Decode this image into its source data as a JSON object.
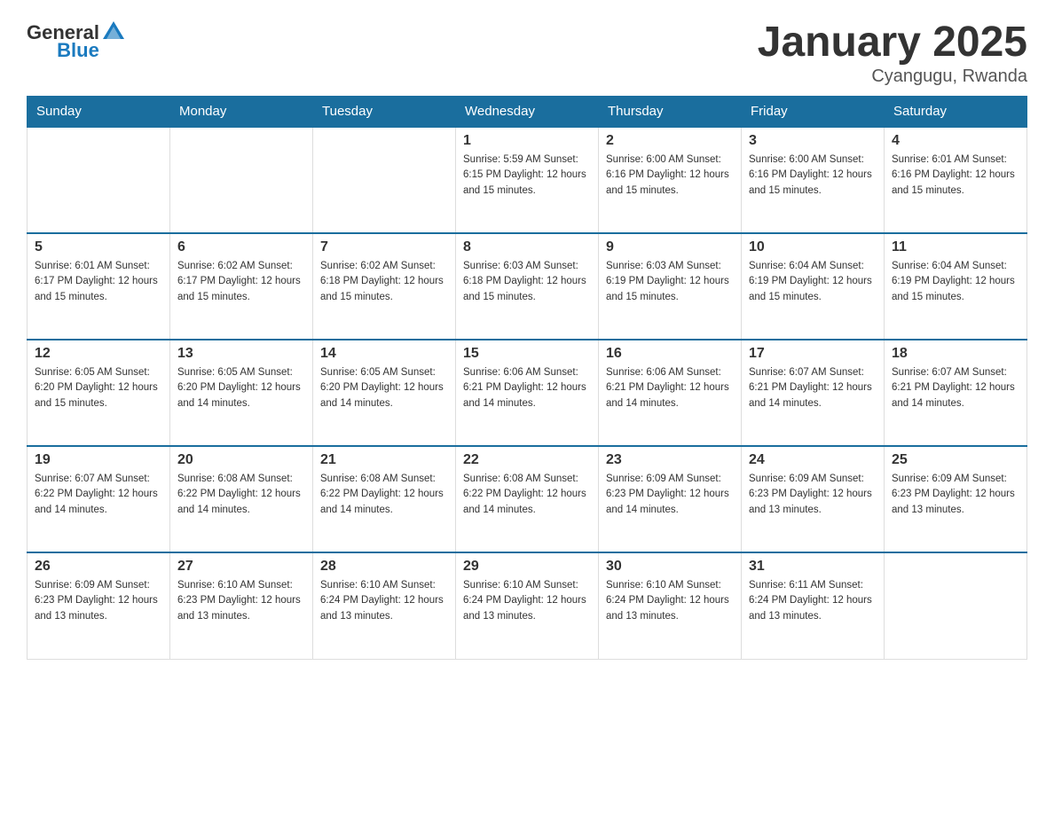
{
  "header": {
    "logo": {
      "general": "General",
      "blue": "Blue"
    },
    "title": "January 2025",
    "location": "Cyangugu, Rwanda"
  },
  "days_of_week": [
    "Sunday",
    "Monday",
    "Tuesday",
    "Wednesday",
    "Thursday",
    "Friday",
    "Saturday"
  ],
  "weeks": [
    {
      "days": [
        {
          "number": "",
          "info": ""
        },
        {
          "number": "",
          "info": ""
        },
        {
          "number": "",
          "info": ""
        },
        {
          "number": "1",
          "info": "Sunrise: 5:59 AM\nSunset: 6:15 PM\nDaylight: 12 hours\nand 15 minutes."
        },
        {
          "number": "2",
          "info": "Sunrise: 6:00 AM\nSunset: 6:16 PM\nDaylight: 12 hours\nand 15 minutes."
        },
        {
          "number": "3",
          "info": "Sunrise: 6:00 AM\nSunset: 6:16 PM\nDaylight: 12 hours\nand 15 minutes."
        },
        {
          "number": "4",
          "info": "Sunrise: 6:01 AM\nSunset: 6:16 PM\nDaylight: 12 hours\nand 15 minutes."
        }
      ]
    },
    {
      "days": [
        {
          "number": "5",
          "info": "Sunrise: 6:01 AM\nSunset: 6:17 PM\nDaylight: 12 hours\nand 15 minutes."
        },
        {
          "number": "6",
          "info": "Sunrise: 6:02 AM\nSunset: 6:17 PM\nDaylight: 12 hours\nand 15 minutes."
        },
        {
          "number": "7",
          "info": "Sunrise: 6:02 AM\nSunset: 6:18 PM\nDaylight: 12 hours\nand 15 minutes."
        },
        {
          "number": "8",
          "info": "Sunrise: 6:03 AM\nSunset: 6:18 PM\nDaylight: 12 hours\nand 15 minutes."
        },
        {
          "number": "9",
          "info": "Sunrise: 6:03 AM\nSunset: 6:19 PM\nDaylight: 12 hours\nand 15 minutes."
        },
        {
          "number": "10",
          "info": "Sunrise: 6:04 AM\nSunset: 6:19 PM\nDaylight: 12 hours\nand 15 minutes."
        },
        {
          "number": "11",
          "info": "Sunrise: 6:04 AM\nSunset: 6:19 PM\nDaylight: 12 hours\nand 15 minutes."
        }
      ]
    },
    {
      "days": [
        {
          "number": "12",
          "info": "Sunrise: 6:05 AM\nSunset: 6:20 PM\nDaylight: 12 hours\nand 15 minutes."
        },
        {
          "number": "13",
          "info": "Sunrise: 6:05 AM\nSunset: 6:20 PM\nDaylight: 12 hours\nand 14 minutes."
        },
        {
          "number": "14",
          "info": "Sunrise: 6:05 AM\nSunset: 6:20 PM\nDaylight: 12 hours\nand 14 minutes."
        },
        {
          "number": "15",
          "info": "Sunrise: 6:06 AM\nSunset: 6:21 PM\nDaylight: 12 hours\nand 14 minutes."
        },
        {
          "number": "16",
          "info": "Sunrise: 6:06 AM\nSunset: 6:21 PM\nDaylight: 12 hours\nand 14 minutes."
        },
        {
          "number": "17",
          "info": "Sunrise: 6:07 AM\nSunset: 6:21 PM\nDaylight: 12 hours\nand 14 minutes."
        },
        {
          "number": "18",
          "info": "Sunrise: 6:07 AM\nSunset: 6:21 PM\nDaylight: 12 hours\nand 14 minutes."
        }
      ]
    },
    {
      "days": [
        {
          "number": "19",
          "info": "Sunrise: 6:07 AM\nSunset: 6:22 PM\nDaylight: 12 hours\nand 14 minutes."
        },
        {
          "number": "20",
          "info": "Sunrise: 6:08 AM\nSunset: 6:22 PM\nDaylight: 12 hours\nand 14 minutes."
        },
        {
          "number": "21",
          "info": "Sunrise: 6:08 AM\nSunset: 6:22 PM\nDaylight: 12 hours\nand 14 minutes."
        },
        {
          "number": "22",
          "info": "Sunrise: 6:08 AM\nSunset: 6:22 PM\nDaylight: 12 hours\nand 14 minutes."
        },
        {
          "number": "23",
          "info": "Sunrise: 6:09 AM\nSunset: 6:23 PM\nDaylight: 12 hours\nand 14 minutes."
        },
        {
          "number": "24",
          "info": "Sunrise: 6:09 AM\nSunset: 6:23 PM\nDaylight: 12 hours\nand 13 minutes."
        },
        {
          "number": "25",
          "info": "Sunrise: 6:09 AM\nSunset: 6:23 PM\nDaylight: 12 hours\nand 13 minutes."
        }
      ]
    },
    {
      "days": [
        {
          "number": "26",
          "info": "Sunrise: 6:09 AM\nSunset: 6:23 PM\nDaylight: 12 hours\nand 13 minutes."
        },
        {
          "number": "27",
          "info": "Sunrise: 6:10 AM\nSunset: 6:23 PM\nDaylight: 12 hours\nand 13 minutes."
        },
        {
          "number": "28",
          "info": "Sunrise: 6:10 AM\nSunset: 6:24 PM\nDaylight: 12 hours\nand 13 minutes."
        },
        {
          "number": "29",
          "info": "Sunrise: 6:10 AM\nSunset: 6:24 PM\nDaylight: 12 hours\nand 13 minutes."
        },
        {
          "number": "30",
          "info": "Sunrise: 6:10 AM\nSunset: 6:24 PM\nDaylight: 12 hours\nand 13 minutes."
        },
        {
          "number": "31",
          "info": "Sunrise: 6:11 AM\nSunset: 6:24 PM\nDaylight: 12 hours\nand 13 minutes."
        },
        {
          "number": "",
          "info": ""
        }
      ]
    }
  ]
}
